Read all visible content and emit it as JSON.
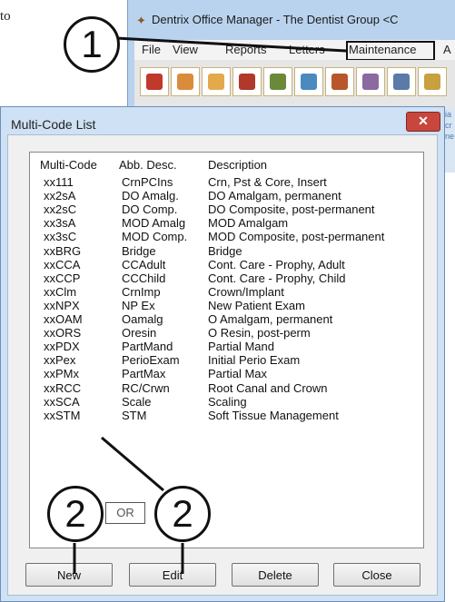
{
  "doc": {
    "fragment": "to"
  },
  "bg_window": {
    "title": "Dentrix Office Manager - The Dentist Group <C",
    "menu": [
      "File",
      "View",
      "Reports",
      "Letters",
      "Maintenance",
      "A"
    ],
    "side_text": [
      "ia",
      "cr",
      "ne"
    ],
    "toolbar_icons": [
      "tooth-icon",
      "folder-icon",
      "notes-icon",
      "book-icon",
      "pen-icon",
      "pencil-icon",
      "stack-icon",
      "chair-icon",
      "monitor-icon",
      "tools-icon"
    ]
  },
  "dialog": {
    "title": "Multi-Code List",
    "close_glyph": "✕",
    "columns": [
      "Multi-Code",
      "Abb. Desc.",
      "Description"
    ],
    "rows": [
      [
        "xx111",
        "CrnPCIns",
        "Crn, Pst & Core, Insert"
      ],
      [
        "xx2sA",
        "DO Amalg.",
        "DO Amalgam, permanent"
      ],
      [
        "xx2sC",
        "DO Comp.",
        "DO Composite, post-permanent"
      ],
      [
        "xx3sA",
        "MOD Amalg",
        "MOD Amalgam"
      ],
      [
        "xx3sC",
        "MOD Comp.",
        "MOD Composite, post-permanent"
      ],
      [
        "xxBRG",
        "Bridge",
        "Bridge"
      ],
      [
        "xxCCA",
        "CCAdult",
        "Cont. Care - Prophy, Adult"
      ],
      [
        "xxCCP",
        "CCChild",
        "Cont. Care - Prophy, Child"
      ],
      [
        "xxClm",
        "CrnImp",
        "Crown/Implant"
      ],
      [
        "xxNPX",
        "NP Ex",
        "New Patient Exam"
      ],
      [
        "xxOAM",
        "Oamalg",
        "O Amalgam, permanent"
      ],
      [
        "xxORS",
        "Oresin",
        "O Resin, post-perm"
      ],
      [
        "xxPDX",
        "PartMand",
        "Partial Mand"
      ],
      [
        "xxPex",
        "PerioExam",
        "Initial Perio Exam"
      ],
      [
        "xxPMx",
        "PartMax",
        "Partial Max"
      ],
      [
        "xxRCC",
        "RC/Crwn",
        "Root Canal and Crown"
      ],
      [
        "xxSCA",
        "Scale",
        "Scaling"
      ],
      [
        "xxSTM",
        "STM",
        "Soft Tissue Management"
      ]
    ],
    "buttons": {
      "new": "New",
      "edit": "Edit",
      "delete": "Delete",
      "close": "Close"
    }
  },
  "callouts": {
    "one": "1",
    "two_left": "2",
    "two_right": "2",
    "or": "OR"
  }
}
